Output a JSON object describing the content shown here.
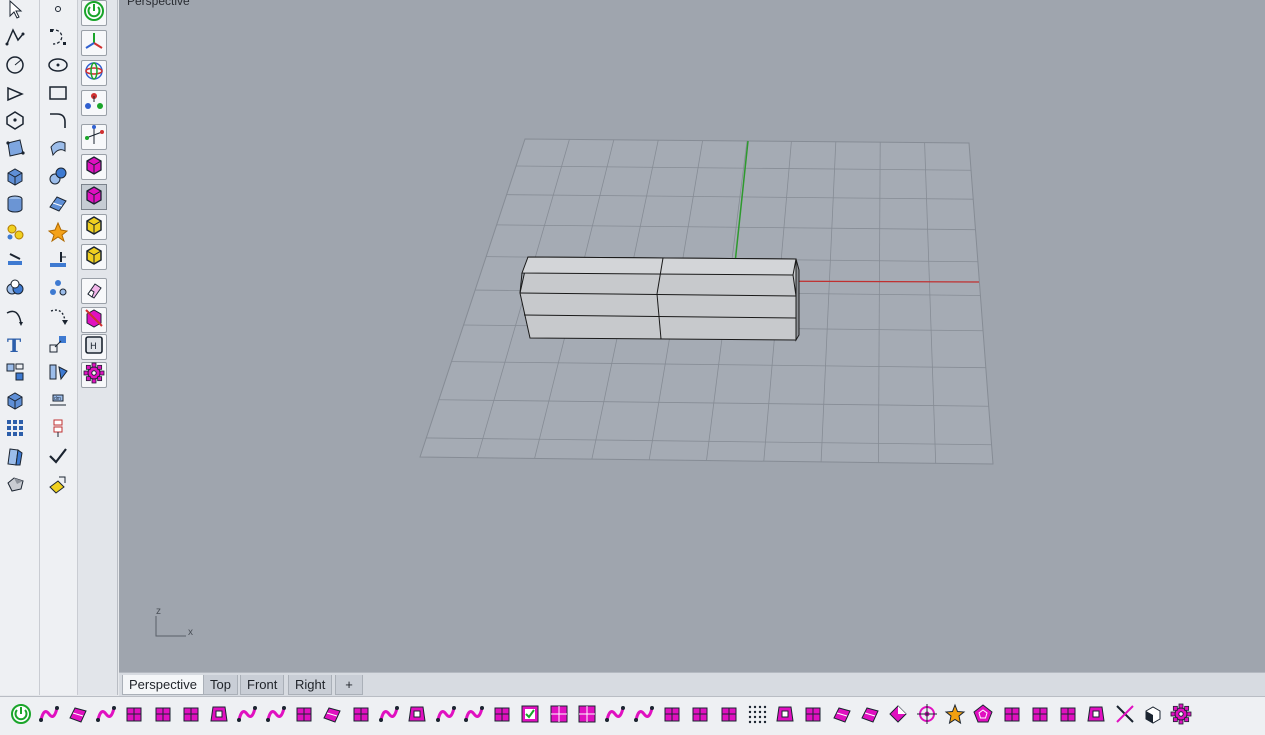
{
  "viewport": {
    "label": "Perspective",
    "axis_z": "z",
    "axis_x": "x"
  },
  "tabs": [
    {
      "label": "Perspective",
      "active": true
    },
    {
      "label": "Top",
      "active": false
    },
    {
      "label": "Front",
      "active": false
    },
    {
      "label": "Right",
      "active": false
    }
  ],
  "add_tab_glyph": "+",
  "colors": {
    "viewport_bg": "#9fa5ae",
    "grid": "#868c95",
    "axis_x": "#c03030",
    "axis_y": "#2e9a2e",
    "accent_magenta": "#e010c0",
    "accent_green": "#1aa52a",
    "accent_yellow": "#f0d020"
  },
  "toolbar_left_1": [
    {
      "icon": "select-arrow-icon"
    },
    {
      "icon": "polyline-icon"
    },
    {
      "icon": "circle-icon"
    },
    {
      "icon": "arc-icon"
    },
    {
      "icon": "polygon-icon"
    },
    {
      "icon": "surface-from-points-icon"
    },
    {
      "icon": "solid-box-icon"
    },
    {
      "icon": "cylinder-icon"
    },
    {
      "icon": "mesh-tools-icon"
    },
    {
      "icon": "transform-icon"
    },
    {
      "icon": "boolean-icon"
    },
    {
      "icon": "curve-from-object-icon"
    },
    {
      "icon": "text-icon"
    },
    {
      "icon": "group-icon"
    },
    {
      "icon": "render-box-icon"
    },
    {
      "icon": "array-icon"
    },
    {
      "icon": "dimension-icon"
    },
    {
      "icon": "shade-icon"
    }
  ],
  "toolbar_left_2": [
    {
      "icon": "point-icon"
    },
    {
      "icon": "curve-icon"
    },
    {
      "icon": "ellipse-icon"
    },
    {
      "icon": "rectangle-icon"
    },
    {
      "icon": "fillet-curve-icon"
    },
    {
      "icon": "extrude-surface-icon"
    },
    {
      "icon": "sphere-icon"
    },
    {
      "icon": "planar-surface-icon"
    },
    {
      "icon": "explode-icon"
    },
    {
      "icon": "project-icon"
    },
    {
      "icon": "scatter-points-icon"
    },
    {
      "icon": "rotate-icon"
    },
    {
      "icon": "scale-icon"
    },
    {
      "icon": "mirror-icon"
    },
    {
      "icon": "layout-icon"
    },
    {
      "icon": "align-icon"
    },
    {
      "icon": "check-icon"
    },
    {
      "icon": "paint-icon"
    }
  ],
  "toolbar_left_3": [
    {
      "icon": "power-icon"
    },
    {
      "icon": "gumball-icon"
    },
    {
      "icon": "orbit-icon"
    },
    {
      "icon": "snap-points-icon"
    },
    {
      "icon": "axis-icon"
    },
    {
      "icon": "cube-magenta-icon"
    },
    {
      "icon": "cube-magenta-selected-icon"
    },
    {
      "icon": "cube-yellow-icon"
    },
    {
      "icon": "cube-yellow-outline-icon"
    },
    {
      "icon": "eraser-icon"
    },
    {
      "icon": "delete-object-icon"
    },
    {
      "icon": "frame-icon"
    },
    {
      "icon": "gear-icon"
    }
  ],
  "bottom_toolbar": [
    "power-icon",
    "box-solid-icon",
    "sphere-mesh-icon",
    "blend-icon",
    "cage-icon",
    "wire-box-icon",
    "fold-icon",
    "branch-icon",
    "rotate-points-icon",
    "twist-icon",
    "arch-icon",
    "extrude-icon",
    "bend-icon",
    "frame-surface-icon",
    "frames-icon",
    "panel-icon",
    "cage-edit-icon",
    "gate-icon",
    "checkbox-icon",
    "grid-icon",
    "tiles-icon",
    "cross-icon",
    "split-icon",
    "trim-icon",
    "flow-icon",
    "tube-icon",
    "dots-grid-icon",
    "corner-icon",
    "hand-icon",
    "scissor-icon",
    "tee-icon",
    "diamond-icon",
    "target-icon",
    "star-icon",
    "pentagon-icon",
    "comb-icon",
    "flag-icon",
    "flat-surface-icon",
    "waffle-icon",
    "x-cross-icon",
    "render-icon",
    "settings-gear-icon"
  ]
}
